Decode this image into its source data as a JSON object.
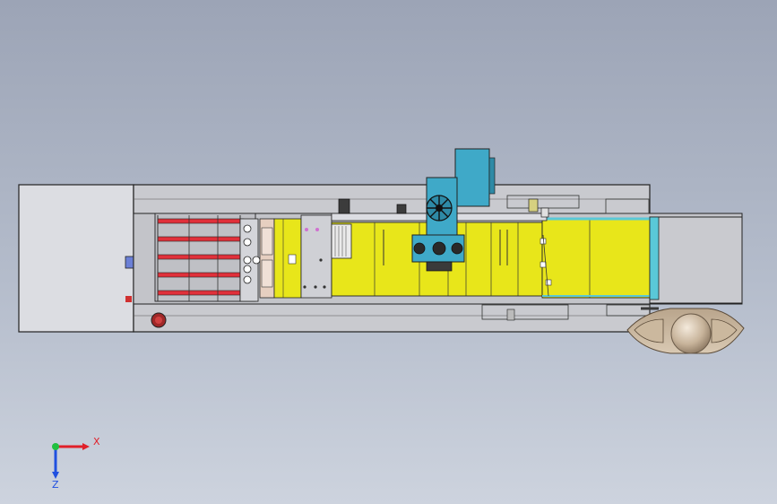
{
  "view": {
    "background_top": "#9ca4b6",
    "background_bottom": "#cdd3de"
  },
  "machine": {
    "frame_color": "#c9cacf",
    "line_color": "#222222",
    "conveyor_color": "#e8e61a",
    "roller_color": "#e0303a",
    "motor_color": "#3fa9c8",
    "belt_color": "#5ac8d8"
  },
  "triad": {
    "x_label": "X",
    "z_label": "Z",
    "x_color": "#e0202a",
    "z_color": "#2050e0",
    "y_color": "#20c040"
  }
}
